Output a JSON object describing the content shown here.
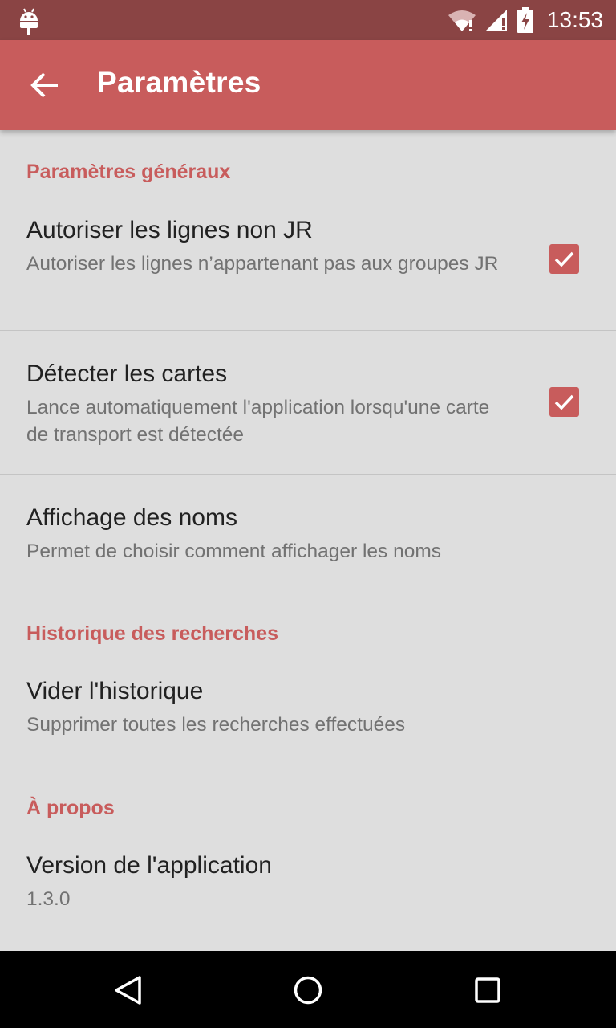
{
  "status_bar": {
    "time": "13:53",
    "icons": [
      "android-debug-icon",
      "wifi-icon",
      "signal-icon",
      "battery-charging-icon"
    ]
  },
  "app_bar": {
    "title": "Paramètres",
    "back_icon": "arrow-back-icon"
  },
  "sections": {
    "general": {
      "header": "Paramètres généraux",
      "allow_non_jr": {
        "title": "Autoriser les lignes non JR",
        "summary": "Autoriser les lignes n’appartenant pas aux groupes JR",
        "checked": true
      },
      "detect_cards": {
        "title": "Détecter les cartes",
        "summary": "Lance automatiquement l'application lorsqu'une carte de transport est détectée",
        "checked": true
      },
      "name_display": {
        "title": "Affichage des noms",
        "summary": "Permet de choisir comment affichager les noms"
      }
    },
    "history": {
      "header": "Historique des recherches",
      "clear": {
        "title": "Vider l'historique",
        "summary": "Supprimer toutes les recherches effectuées"
      }
    },
    "about": {
      "header": "À propos",
      "version": {
        "title": "Version de l'application",
        "summary": "1.3.0"
      }
    }
  },
  "nav_bar": {
    "buttons": [
      "back-triangle-icon",
      "home-circle-icon",
      "recents-square-icon"
    ]
  },
  "colors": {
    "accent": "#c85c5c",
    "status_bar": "#8a4444",
    "background": "#dedede"
  }
}
